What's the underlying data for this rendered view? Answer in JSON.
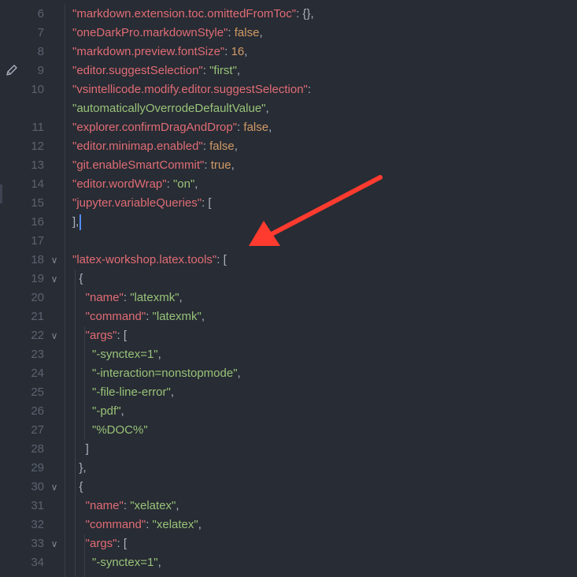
{
  "editor": {
    "accent_color": "#ff3b2f",
    "lines": [
      {
        "num": "6",
        "code": [
          {
            "t": "\"markdown.extension.toc.omittedFromToc\"",
            "c": "k"
          },
          {
            "t": ": {},",
            "c": "p"
          }
        ]
      },
      {
        "num": "7",
        "code": [
          {
            "t": "\"oneDarkPro.markdownStyle\"",
            "c": "k"
          },
          {
            "t": ": ",
            "c": "p"
          },
          {
            "t": "false",
            "c": "c"
          },
          {
            "t": ",",
            "c": "p"
          }
        ]
      },
      {
        "num": "8",
        "code": [
          {
            "t": "\"markdown.preview.fontSize\"",
            "c": "k"
          },
          {
            "t": ": ",
            "c": "p"
          },
          {
            "t": "16",
            "c": "c"
          },
          {
            "t": ",",
            "c": "p"
          }
        ]
      },
      {
        "num": "9",
        "code": [
          {
            "t": "\"editor.suggestSelection\"",
            "c": "k"
          },
          {
            "t": ": ",
            "c": "p"
          },
          {
            "t": "\"first\"",
            "c": "s"
          },
          {
            "t": ",",
            "c": "p"
          }
        ]
      },
      {
        "num": "10",
        "code": [
          {
            "t": "\"vsintellicode.modify.editor.suggestSelection\"",
            "c": "k"
          },
          {
            "t": ":",
            "c": "p"
          }
        ]
      },
      {
        "num": "",
        "code": [
          {
            "t": "\"automaticallyOverrodeDefaultValue\"",
            "c": "s"
          },
          {
            "t": ",",
            "c": "p"
          }
        ]
      },
      {
        "num": "11",
        "code": [
          {
            "t": "\"explorer.confirmDragAndDrop\"",
            "c": "k"
          },
          {
            "t": ": ",
            "c": "p"
          },
          {
            "t": "false",
            "c": "c"
          },
          {
            "t": ",",
            "c": "p"
          }
        ]
      },
      {
        "num": "12",
        "code": [
          {
            "t": "\"editor.minimap.enabled\"",
            "c": "k"
          },
          {
            "t": ": ",
            "c": "p"
          },
          {
            "t": "false",
            "c": "c"
          },
          {
            "t": ",",
            "c": "p"
          }
        ]
      },
      {
        "num": "13",
        "code": [
          {
            "t": "\"git.enableSmartCommit\"",
            "c": "k"
          },
          {
            "t": ": ",
            "c": "p"
          },
          {
            "t": "true",
            "c": "c"
          },
          {
            "t": ",",
            "c": "p"
          }
        ]
      },
      {
        "num": "14",
        "code": [
          {
            "t": "\"editor.wordWrap\"",
            "c": "k"
          },
          {
            "t": ": ",
            "c": "p"
          },
          {
            "t": "\"on\"",
            "c": "s"
          },
          {
            "t": ",",
            "c": "p"
          }
        ]
      },
      {
        "num": "15",
        "code": [
          {
            "t": "\"jupyter.variableQueries\"",
            "c": "k"
          },
          {
            "t": ": [",
            "c": "p"
          }
        ]
      },
      {
        "num": "16",
        "code": [
          {
            "t": "],",
            "c": "p"
          }
        ],
        "cursor": true
      },
      {
        "num": "17",
        "code": []
      },
      {
        "num": "18",
        "fold": true,
        "code": [
          {
            "t": "\"latex-workshop.latex.tools\"",
            "c": "k"
          },
          {
            "t": ": [",
            "c": "p"
          }
        ]
      },
      {
        "num": "19",
        "fold": true,
        "code": [
          {
            "t": "  {",
            "c": "p"
          }
        ]
      },
      {
        "num": "20",
        "code": [
          {
            "t": "    ",
            "c": "p"
          },
          {
            "t": "\"name\"",
            "c": "k"
          },
          {
            "t": ": ",
            "c": "p"
          },
          {
            "t": "\"latexmk\"",
            "c": "s"
          },
          {
            "t": ",",
            "c": "p"
          }
        ]
      },
      {
        "num": "21",
        "code": [
          {
            "t": "    ",
            "c": "p"
          },
          {
            "t": "\"command\"",
            "c": "k"
          },
          {
            "t": ": ",
            "c": "p"
          },
          {
            "t": "\"latexmk\"",
            "c": "s"
          },
          {
            "t": ",",
            "c": "p"
          }
        ]
      },
      {
        "num": "22",
        "fold": true,
        "code": [
          {
            "t": "    ",
            "c": "p"
          },
          {
            "t": "\"args\"",
            "c": "k"
          },
          {
            "t": ": [",
            "c": "p"
          }
        ]
      },
      {
        "num": "23",
        "code": [
          {
            "t": "      ",
            "c": "p"
          },
          {
            "t": "\"-synctex=1\"",
            "c": "s"
          },
          {
            "t": ",",
            "c": "p"
          }
        ]
      },
      {
        "num": "24",
        "code": [
          {
            "t": "      ",
            "c": "p"
          },
          {
            "t": "\"-interaction=nonstopmode\"",
            "c": "s"
          },
          {
            "t": ",",
            "c": "p"
          }
        ]
      },
      {
        "num": "25",
        "code": [
          {
            "t": "      ",
            "c": "p"
          },
          {
            "t": "\"-file-line-error\"",
            "c": "s"
          },
          {
            "t": ",",
            "c": "p"
          }
        ]
      },
      {
        "num": "26",
        "code": [
          {
            "t": "      ",
            "c": "p"
          },
          {
            "t": "\"-pdf\"",
            "c": "s"
          },
          {
            "t": ",",
            "c": "p"
          }
        ]
      },
      {
        "num": "27",
        "code": [
          {
            "t": "      ",
            "c": "p"
          },
          {
            "t": "\"%DOC%\"",
            "c": "s"
          }
        ]
      },
      {
        "num": "28",
        "code": [
          {
            "t": "    ]",
            "c": "p"
          }
        ]
      },
      {
        "num": "29",
        "code": [
          {
            "t": "  },",
            "c": "p"
          }
        ]
      },
      {
        "num": "30",
        "fold": true,
        "code": [
          {
            "t": "  {",
            "c": "p"
          }
        ]
      },
      {
        "num": "31",
        "code": [
          {
            "t": "    ",
            "c": "p"
          },
          {
            "t": "\"name\"",
            "c": "k"
          },
          {
            "t": ": ",
            "c": "p"
          },
          {
            "t": "\"xelatex\"",
            "c": "s"
          },
          {
            "t": ",",
            "c": "p"
          }
        ]
      },
      {
        "num": "32",
        "code": [
          {
            "t": "    ",
            "c": "p"
          },
          {
            "t": "\"command\"",
            "c": "k"
          },
          {
            "t": ": ",
            "c": "p"
          },
          {
            "t": "\"xelatex\"",
            "c": "s"
          },
          {
            "t": ",",
            "c": "p"
          }
        ]
      },
      {
        "num": "33",
        "fold": true,
        "code": [
          {
            "t": "    ",
            "c": "p"
          },
          {
            "t": "\"args\"",
            "c": "k"
          },
          {
            "t": ": [",
            "c": "p"
          }
        ]
      },
      {
        "num": "34",
        "code": [
          {
            "t": "      ",
            "c": "p"
          },
          {
            "t": "\"-synctex=1\"",
            "c": "s"
          },
          {
            "t": ",",
            "c": "p"
          }
        ]
      }
    ]
  }
}
